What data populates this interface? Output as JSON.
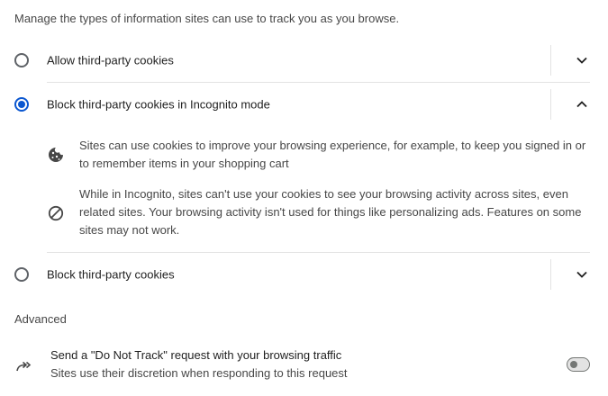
{
  "intro": "Manage the types of information sites can use to track you as you browse.",
  "options": [
    {
      "label": "Allow third-party cookies",
      "selected": false,
      "expanded": false
    },
    {
      "label": "Block third-party cookies in Incognito mode",
      "selected": true,
      "expanded": true
    },
    {
      "label": "Block third-party cookies",
      "selected": false,
      "expanded": false
    }
  ],
  "incognito_details": [
    {
      "icon": "cookie-icon",
      "text": "Sites can use cookies to improve your browsing experience, for example, to keep you signed in or to remember items in your shopping cart"
    },
    {
      "icon": "block-icon",
      "text": "While in Incognito, sites can't use your cookies to see your browsing activity across sites, even related sites. Your browsing activity isn't used for things like personalizing ads. Features on some sites may not work."
    }
  ],
  "advanced": {
    "title": "Advanced",
    "do_not_track": {
      "icon": "do-not-track-icon",
      "title": "Send a \"Do Not Track\" request with your browsing traffic",
      "subtitle": "Sites use their discretion when responding to this request",
      "enabled": false
    }
  },
  "colors": {
    "accent": "#0b57d0",
    "text": "#1f1f1f",
    "secondary": "#474747",
    "divider": "#e3e3e3"
  }
}
